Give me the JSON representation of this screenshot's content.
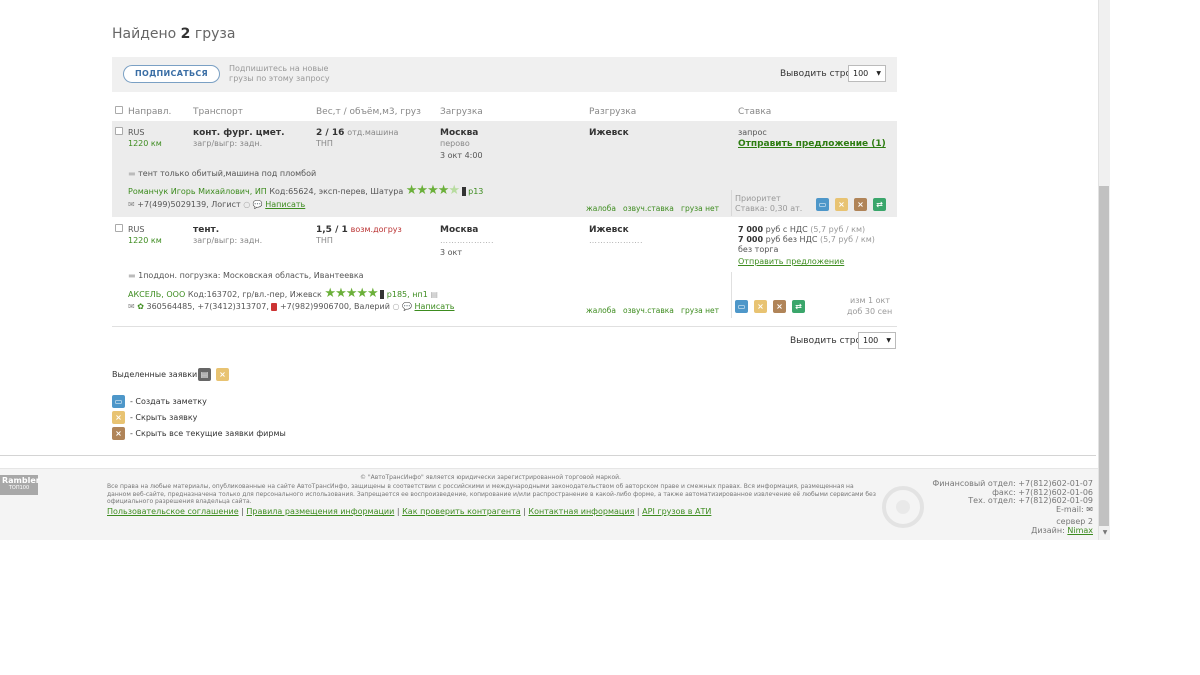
{
  "header": {
    "found_prefix": "Найдено",
    "found_count": "2",
    "found_suffix": "груза"
  },
  "subscribe": {
    "button": "ПОДПИСАТЬСЯ",
    "hint": "Подпишитесь на новые грузы по этому запросу"
  },
  "rows_per_page": {
    "label": "Выводить строк",
    "value": "100"
  },
  "columns": {
    "direction": "Направл.",
    "transport": "Транспорт",
    "weight": "Вес,т / объём,м3, груз",
    "loading": "Загрузка",
    "unloading": "Разгрузка",
    "rate": "Ставка"
  },
  "rows": [
    {
      "country": "RUS",
      "distance": "1220 км",
      "transport_type": "конт. фург. цмет.",
      "transport_load": "загр/выгр: задн.",
      "weight": "2 / 16",
      "weight_note": "отд.машина",
      "cargo": "ТНП",
      "load_city": "Москва",
      "load_place": "перово",
      "load_date": "3 окт 4:00",
      "unload_city": "Ижевск",
      "rate_text": "запрос",
      "rate_link": "Отправить предложение (1)",
      "note": "тент только обитый,машина под пломбой",
      "company_name": "Романчук Игорь Михайлович, ИП",
      "company_info": "Код:65624, эксп-перев, Шатура",
      "rating_filled": 3.5,
      "rating_total": 5,
      "company_badge": "р13",
      "phone": "+7(499)5029139, Логист",
      "write_link": "Написать",
      "complaint": "жалоба",
      "voiced_rate": "озвуч.ставка",
      "no_cargo": "груза нет",
      "priority_label": "Приоритет",
      "priority_rate": "Ставка: 0,30 ат."
    },
    {
      "country": "RUS",
      "distance": "1220 км",
      "transport_type": "тент.",
      "transport_load": "загр/выгр: задн.",
      "weight": "1,5 / 1",
      "weight_note": "возм.догруз",
      "cargo": "ТНП",
      "load_city": "Москва",
      "load_place": "……………….",
      "load_date": "3 окт",
      "unload_city": "Ижевск",
      "unload_place": "……………….",
      "rate_vat_amount": "7 000",
      "rate_vat_text": "руб с НДС",
      "rate_vat_per_km": "(5,7 руб / км)",
      "rate_novat_amount": "7 000",
      "rate_novat_text": "руб без НДС",
      "rate_novat_per_km": "(5,7 руб / км)",
      "rate_no_haggle": "без торга",
      "rate_link": "Отправить предложение",
      "note": "1поддон. погрузка: Московская область, Ивантеевка",
      "company_name": "АКСЕЛЬ, ООО",
      "company_info": "Код:163702, гр/вл.-пер, Ижевск",
      "rating_filled": 5,
      "rating_total": 5,
      "company_badge": "р185, нп1",
      "phone": "360564485, +7(3412)313707,",
      "phone2": "+7(982)9906700, Валерий",
      "write_link": "Написать",
      "complaint": "жалоба",
      "voiced_rate": "озвуч.ставка",
      "no_cargo": "груза нет",
      "changed": "изм 1 окт",
      "added": "доб 30 сен"
    }
  ],
  "selected": {
    "label": "Выделенные заявки:"
  },
  "legend": [
    {
      "icon": "note-icon",
      "text": "- Создать заметку"
    },
    {
      "icon": "hide-icon",
      "text": "- Скрыть заявку"
    },
    {
      "icon": "hide-all-icon",
      "text": "- Скрыть все текущие заявки фирмы"
    }
  ],
  "footer": {
    "copyright": "© \"АвтоТрансИнфо\" является юридически зарегистрированной торговой маркой.",
    "rights": "Все права на любые материалы, опубликованные на сайте АвтоТрансИнфо, защищены в соответствии с российскими и международными законодательством об авторском праве и смежных правах. Вся информация, размещенная на данном веб-сайте, предназначена только для персонального использования. Запрещается ее воспроизведение, копирование и/или распространение в какой-либо форме, а также автоматизированное извлечение её любыми сервисами без официального разрешения владельца сайта.",
    "links": [
      "Пользовательское соглашение",
      "Правила размещения информации",
      "Как проверить контрагента",
      "Контактная информация",
      "API грузов в АТИ"
    ],
    "finance": "Финансовый отдел: +7(812)602-01-07",
    "fax": "факс: +7(812)602-01-06",
    "tech": "Тех. отдел: +7(812)602-01-09",
    "email": "E-mail:",
    "server": "сервер 2",
    "design_label": "Дизайн:",
    "design_link": "Nimax",
    "rambler": "Rambler",
    "rambler_top": "ТОП100"
  }
}
